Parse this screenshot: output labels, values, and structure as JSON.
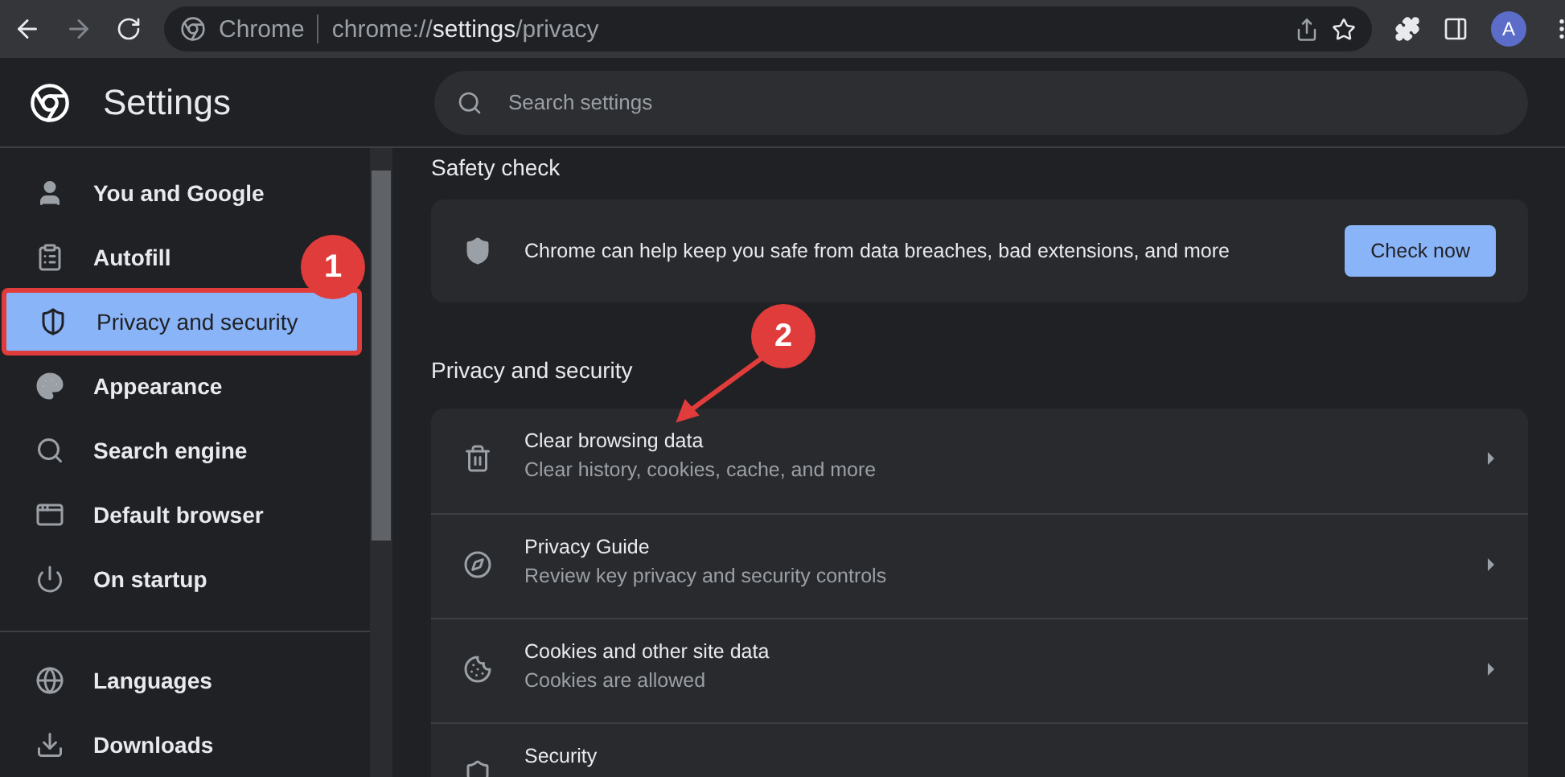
{
  "browser": {
    "site_label": "Chrome",
    "url": "chrome://**settings**/privacy",
    "avatar": "A"
  },
  "header": {
    "title": "Settings",
    "search": {
      "placeholder": "Search settings"
    }
  },
  "sidebar": {
    "groups": [
      {
        "items": [
          {
            "label": "You and Google",
            "selected": false,
            "highlighted": false
          },
          {
            "label": "Autofill",
            "selected": false,
            "highlighted": false
          },
          {
            "label": "Privacy and security",
            "selected": true,
            "highlighted": true
          },
          {
            "label": "Appearance",
            "selected": false,
            "highlighted": false
          },
          {
            "label": "Search engine",
            "selected": false,
            "highlighted": false
          },
          {
            "label": "Default browser",
            "selected": false,
            "highlighted": false
          },
          {
            "label": "On startup",
            "selected": false,
            "highlighted": false
          }
        ]
      },
      {
        "items": [
          {
            "label": "Languages",
            "selected": false,
            "highlighted": false
          },
          {
            "label": "Downloads",
            "selected": false,
            "highlighted": false
          }
        ]
      }
    ]
  },
  "safety_check": {
    "heading": "Safety check",
    "text": "Chrome can help keep you safe from data breaches, bad extensions, and more",
    "button": "Check now"
  },
  "privacy": {
    "heading": "Privacy and security",
    "rows": [
      {
        "title": "Clear browsing data",
        "subtitle": "Clear history, cookies, cache, and more"
      },
      {
        "title": "Privacy Guide",
        "subtitle": "Review key privacy and security controls"
      },
      {
        "title": "Cookies and other site data",
        "subtitle": "Cookies are allowed"
      },
      {
        "title": "Security"
      }
    ]
  },
  "annotations": [
    {
      "label": "1"
    },
    {
      "label": "2"
    }
  ]
}
